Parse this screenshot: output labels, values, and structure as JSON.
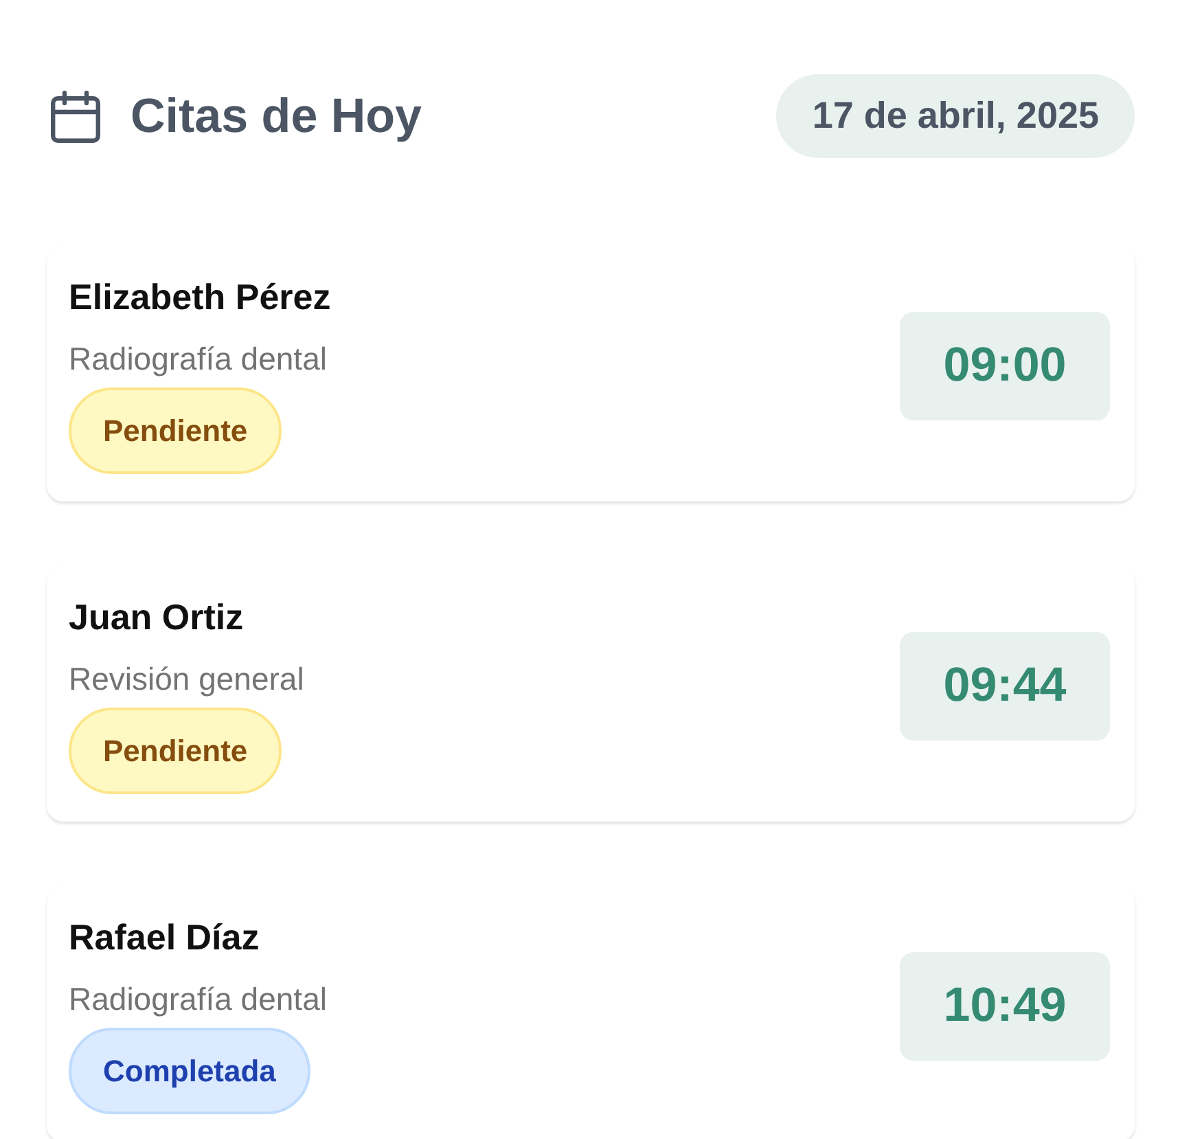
{
  "header": {
    "title": "Citas de Hoy",
    "date": "17 de abril, 2025"
  },
  "appointments": [
    {
      "patient": "Elizabeth Pérez",
      "service": "Radiografía dental",
      "status": {
        "label": "Pendiente",
        "kind": "pending"
      },
      "time": "09:00"
    },
    {
      "patient": "Juan Ortiz",
      "service": "Revisión general",
      "status": {
        "label": "Pendiente",
        "kind": "pending"
      },
      "time": "09:44"
    },
    {
      "patient": "Rafael Díaz",
      "service": "Radiografía dental",
      "status": {
        "label": "Completada",
        "kind": "completed"
      },
      "time": "10:49"
    }
  ]
}
